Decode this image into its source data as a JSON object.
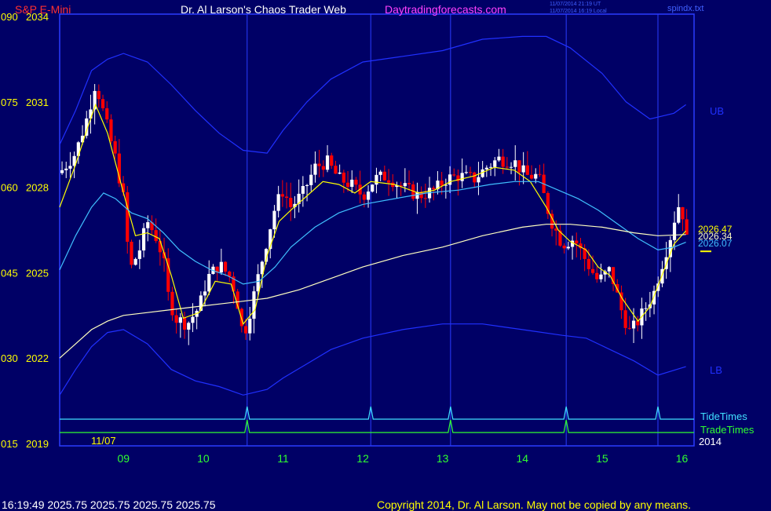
{
  "header": {
    "symbol": "S&P E-Mini",
    "title": "Dr. Al Larson's Chaos Trader Web",
    "site": "Daytradingforecasts.com",
    "stamp_utc": "11/07/2014 21:19 UT",
    "stamp_local": "11/07/2014 16:19 Local",
    "filename": "spindx.txt"
  },
  "footer": {
    "quote": "16:19:49  2025.75  2025.75  2025.75  2025.75",
    "copyright": "Copyright 2014, Dr. Al Larson. May not be copied by any means."
  },
  "colors": {
    "background": "#000066",
    "up_bar": "#ffffff",
    "down_bar": "#ff0000",
    "fast_ma": "#ffff00",
    "mid_ma": "#40c0ff",
    "slow_ma": "#ffffc0",
    "bands": "#2030ff",
    "tide": "#40e0ff",
    "trade": "#30ff30",
    "axis_left": "#ffff00",
    "axis_bottom": "#30ff30"
  },
  "chart_data": {
    "type": "candlestick",
    "y_labels_left": [
      {
        "code": "090",
        "price": "2034"
      },
      {
        "code": "075",
        "price": "2031"
      },
      {
        "code": "060",
        "price": "2028"
      },
      {
        "code": "045",
        "price": "2025"
      },
      {
        "code": "030",
        "price": "2022"
      },
      {
        "code": "015",
        "price": "2019"
      }
    ],
    "ylim": [
      2019,
      2034
    ],
    "x_ticks": [
      "09",
      "10",
      "11",
      "12",
      "13",
      "14",
      "15",
      "16"
    ],
    "date_label": "11/07",
    "year_label": "2014",
    "xlim": [
      8.2,
      16.1
    ],
    "band_labels": {
      "upper": "UB",
      "lower": "LB"
    },
    "price_labels": [
      {
        "text": "2026.47",
        "color": "#ffff00"
      },
      {
        "text": "2026.34",
        "color": "#ffffc0"
      },
      {
        "text": "2026.07",
        "color": "#40c0ff"
      }
    ],
    "last_price": 2025.75,
    "tide_label": "TideTimes",
    "trade_label": "TradeTimes",
    "tide_times": [
      10.55,
      12.1,
      13.1,
      14.55,
      15.7
    ],
    "trade_times": [
      10.55,
      13.1,
      14.55
    ],
    "vertical_lines": [
      10.55,
      12.1,
      13.1,
      14.55,
      15.7
    ],
    "close_path": [
      [
        8.2,
        2028.5
      ],
      [
        8.4,
        2029.2
      ],
      [
        8.55,
        2030.5
      ],
      [
        8.65,
        2031.7
      ],
      [
        8.75,
        2030.6
      ],
      [
        8.9,
        2029.0
      ],
      [
        9.0,
        2027.6
      ],
      [
        9.05,
        2026.0
      ],
      [
        9.1,
        2025.2
      ],
      [
        9.2,
        2025.8
      ],
      [
        9.3,
        2026.8
      ],
      [
        9.4,
        2026.3
      ],
      [
        9.5,
        2025.5
      ],
      [
        9.55,
        2024.3
      ],
      [
        9.65,
        2023.4
      ],
      [
        9.8,
        2023.2
      ],
      [
        9.95,
        2023.8
      ],
      [
        10.05,
        2024.8
      ],
      [
        10.2,
        2025.3
      ],
      [
        10.35,
        2024.8
      ],
      [
        10.45,
        2023.7
      ],
      [
        10.5,
        2022.7
      ],
      [
        10.6,
        2023.8
      ],
      [
        10.75,
        2025.6
      ],
      [
        10.9,
        2027.3
      ],
      [
        11.0,
        2027.9
      ],
      [
        11.1,
        2027.3
      ],
      [
        11.25,
        2027.8
      ],
      [
        11.4,
        2028.7
      ],
      [
        11.55,
        2028.9
      ],
      [
        11.7,
        2028.3
      ],
      [
        11.85,
        2028.1
      ],
      [
        12.0,
        2027.7
      ],
      [
        12.15,
        2028.3
      ],
      [
        12.3,
        2028.4
      ],
      [
        12.5,
        2028.0
      ],
      [
        12.7,
        2027.7
      ],
      [
        12.9,
        2027.9
      ],
      [
        13.05,
        2028.3
      ],
      [
        13.2,
        2028.4
      ],
      [
        13.4,
        2028.3
      ],
      [
        13.55,
        2028.7
      ],
      [
        13.7,
        2029.0
      ],
      [
        13.9,
        2028.9
      ],
      [
        14.05,
        2028.4
      ],
      [
        14.2,
        2028.4
      ],
      [
        14.35,
        2026.9
      ],
      [
        14.5,
        2026.0
      ],
      [
        14.65,
        2026.2
      ],
      [
        14.8,
        2025.4
      ],
      [
        14.95,
        2024.7
      ],
      [
        15.1,
        2025.1
      ],
      [
        15.25,
        2023.6
      ],
      [
        15.35,
        2022.9
      ],
      [
        15.45,
        2023.3
      ],
      [
        15.55,
        2023.8
      ],
      [
        15.65,
        2024.3
      ],
      [
        15.75,
        2025.3
      ],
      [
        15.85,
        2026.2
      ],
      [
        15.95,
        2027.4
      ],
      [
        16.02,
        2027.0
      ],
      [
        16.08,
        2025.75
      ]
    ],
    "series": [
      {
        "name": "fast_ma",
        "values": [
          [
            8.2,
            2027.3
          ],
          [
            8.4,
            2028.8
          ],
          [
            8.55,
            2030.1
          ],
          [
            8.65,
            2030.9
          ],
          [
            8.8,
            2029.9
          ],
          [
            9.0,
            2027.8
          ],
          [
            9.15,
            2026.3
          ],
          [
            9.3,
            2026.4
          ],
          [
            9.45,
            2026.2
          ],
          [
            9.6,
            2024.9
          ],
          [
            9.75,
            2023.4
          ],
          [
            9.95,
            2023.6
          ],
          [
            10.15,
            2024.7
          ],
          [
            10.35,
            2024.6
          ],
          [
            10.5,
            2023.2
          ],
          [
            10.65,
            2023.7
          ],
          [
            10.8,
            2025.6
          ],
          [
            10.95,
            2026.8
          ],
          [
            11.1,
            2027.2
          ],
          [
            11.3,
            2027.7
          ],
          [
            11.5,
            2028.2
          ],
          [
            11.7,
            2028.1
          ],
          [
            11.9,
            2027.8
          ],
          [
            12.1,
            2028.2
          ],
          [
            12.4,
            2028.1
          ],
          [
            12.7,
            2027.8
          ],
          [
            12.9,
            2027.9
          ],
          [
            13.1,
            2028.2
          ],
          [
            13.4,
            2028.4
          ],
          [
            13.65,
            2028.7
          ],
          [
            13.9,
            2028.6
          ],
          [
            14.1,
            2028.2
          ],
          [
            14.3,
            2027.3
          ],
          [
            14.45,
            2026.5
          ],
          [
            14.6,
            2026.1
          ],
          [
            14.8,
            2025.8
          ],
          [
            14.95,
            2025.2
          ],
          [
            15.1,
            2024.9
          ],
          [
            15.25,
            2024.1
          ],
          [
            15.45,
            2023.3
          ],
          [
            15.6,
            2023.8
          ],
          [
            15.75,
            2024.9
          ],
          [
            15.9,
            2026.0
          ],
          [
            16.05,
            2026.47
          ]
        ]
      },
      {
        "name": "mid_ma",
        "values": [
          [
            8.2,
            2025.1
          ],
          [
            8.4,
            2026.3
          ],
          [
            8.6,
            2027.3
          ],
          [
            8.75,
            2027.8
          ],
          [
            8.9,
            2027.6
          ],
          [
            9.1,
            2027.1
          ],
          [
            9.3,
            2026.9
          ],
          [
            9.5,
            2026.4
          ],
          [
            9.7,
            2025.8
          ],
          [
            9.9,
            2025.4
          ],
          [
            10.1,
            2025.1
          ],
          [
            10.3,
            2024.9
          ],
          [
            10.5,
            2024.6
          ],
          [
            10.7,
            2024.7
          ],
          [
            10.9,
            2025.2
          ],
          [
            11.1,
            2025.9
          ],
          [
            11.4,
            2026.6
          ],
          [
            11.7,
            2027.1
          ],
          [
            12.0,
            2027.4
          ],
          [
            12.4,
            2027.6
          ],
          [
            12.8,
            2027.8
          ],
          [
            13.2,
            2027.9
          ],
          [
            13.6,
            2028.1
          ],
          [
            13.9,
            2028.2
          ],
          [
            14.2,
            2028.2
          ],
          [
            14.45,
            2027.9
          ],
          [
            14.7,
            2027.6
          ],
          [
            14.95,
            2027.2
          ],
          [
            15.2,
            2026.7
          ],
          [
            15.45,
            2026.2
          ],
          [
            15.7,
            2025.8
          ],
          [
            15.9,
            2025.9
          ],
          [
            16.05,
            2026.07
          ]
        ]
      },
      {
        "name": "slow_ma",
        "values": [
          [
            8.2,
            2022.0
          ],
          [
            8.4,
            2022.5
          ],
          [
            8.6,
            2023.0
          ],
          [
            8.8,
            2023.3
          ],
          [
            9.0,
            2023.5
          ],
          [
            9.3,
            2023.6
          ],
          [
            9.6,
            2023.7
          ],
          [
            9.9,
            2023.8
          ],
          [
            10.2,
            2023.9
          ],
          [
            10.5,
            2024.0
          ],
          [
            10.8,
            2024.1
          ],
          [
            11.2,
            2024.4
          ],
          [
            11.6,
            2024.8
          ],
          [
            12.0,
            2025.2
          ],
          [
            12.5,
            2025.6
          ],
          [
            13.0,
            2025.9
          ],
          [
            13.5,
            2026.3
          ],
          [
            14.0,
            2026.6
          ],
          [
            14.3,
            2026.7
          ],
          [
            14.6,
            2026.7
          ],
          [
            15.0,
            2026.6
          ],
          [
            15.4,
            2026.4
          ],
          [
            15.7,
            2026.3
          ],
          [
            16.05,
            2026.34
          ]
        ]
      },
      {
        "name": "upper_band",
        "values": [
          [
            8.2,
            2029.5
          ],
          [
            8.4,
            2030.7
          ],
          [
            8.6,
            2032.1
          ],
          [
            8.8,
            2032.5
          ],
          [
            9.0,
            2032.7
          ],
          [
            9.3,
            2032.4
          ],
          [
            9.6,
            2031.6
          ],
          [
            9.9,
            2030.7
          ],
          [
            10.2,
            2029.9
          ],
          [
            10.5,
            2029.3
          ],
          [
            10.8,
            2029.2
          ],
          [
            11.0,
            2030.0
          ],
          [
            11.3,
            2031.0
          ],
          [
            11.6,
            2031.8
          ],
          [
            12.0,
            2032.4
          ],
          [
            12.5,
            2032.6
          ],
          [
            13.0,
            2032.8
          ],
          [
            13.5,
            2033.2
          ],
          [
            14.0,
            2033.3
          ],
          [
            14.3,
            2033.3
          ],
          [
            14.6,
            2032.9
          ],
          [
            15.0,
            2032.0
          ],
          [
            15.3,
            2031.0
          ],
          [
            15.6,
            2030.4
          ],
          [
            15.9,
            2030.6
          ],
          [
            16.05,
            2030.9
          ]
        ]
      },
      {
        "name": "lower_band",
        "values": [
          [
            8.2,
            2020.7
          ],
          [
            8.4,
            2021.6
          ],
          [
            8.6,
            2022.4
          ],
          [
            8.8,
            2022.9
          ],
          [
            9.0,
            2023.0
          ],
          [
            9.3,
            2022.5
          ],
          [
            9.6,
            2021.6
          ],
          [
            9.9,
            2021.2
          ],
          [
            10.2,
            2021.0
          ],
          [
            10.5,
            2020.7
          ],
          [
            10.8,
            2020.9
          ],
          [
            11.0,
            2021.3
          ],
          [
            11.3,
            2021.8
          ],
          [
            11.6,
            2022.3
          ],
          [
            12.0,
            2022.7
          ],
          [
            12.5,
            2023.0
          ],
          [
            13.0,
            2023.2
          ],
          [
            13.5,
            2023.2
          ],
          [
            14.0,
            2023.0
          ],
          [
            14.5,
            2022.8
          ],
          [
            14.8,
            2022.7
          ],
          [
            15.1,
            2022.3
          ],
          [
            15.4,
            2021.9
          ],
          [
            15.7,
            2021.4
          ],
          [
            16.05,
            2021.7
          ]
        ]
      }
    ]
  }
}
